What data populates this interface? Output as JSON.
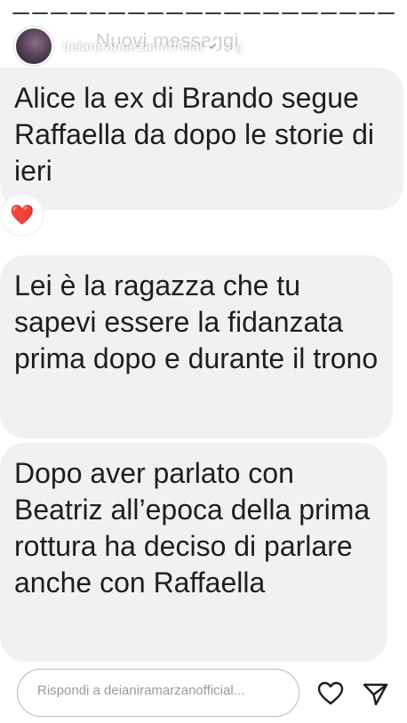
{
  "story": {
    "username": "deianiramarzanofficial",
    "time_ago": "1 g",
    "faded_title": "Nuovi messaggi"
  },
  "messages": [
    {
      "text": "Alice la ex di Brando segue Raffaella da dopo le storie di ieri",
      "reaction": "❤️"
    },
    {
      "text": "Lei è la ragazza che tu sapevi essere la fidanzata prima dopo e durante il trono"
    },
    {
      "text": "Dopo aver parlato con Beatriz all’epoca della prima rottura ha deciso di parlare anche con Raffaella"
    }
  ],
  "reply": {
    "placeholder": "Rispondi a deianiramarzanofficial..."
  },
  "icons": {
    "verified": "verified-badge-icon",
    "play": "play-icon",
    "more": "more-horizontal-icon",
    "heart": "heart-outline-icon",
    "send": "paper-plane-icon"
  },
  "colors": {
    "bubble_bg": "#f1f1f3",
    "text": "#1e1e1e"
  }
}
